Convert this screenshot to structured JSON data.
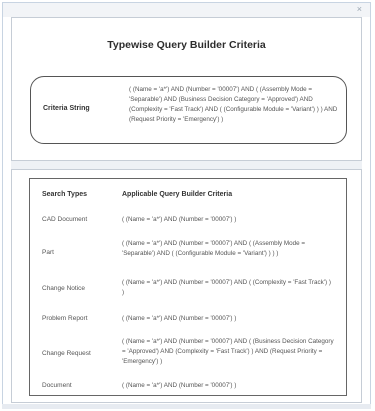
{
  "dialog": {
    "close_label": "×",
    "title": "Typewise Query Builder Criteria"
  },
  "criteria_string": {
    "label": "Criteria String",
    "value": "( (Name = 'a*') AND (Number = '00007') AND ( (Assembly Mode = 'Separable') AND (Business Decision Category = 'Approved') AND (Complexity = 'Fast Track') AND ( (Configurable Module = 'Variant') ) ) AND (Request Priority = 'Emergency') )"
  },
  "table": {
    "headers": {
      "types": "Search Types",
      "criteria": "Applicable Query Builder Criteria"
    },
    "rows": [
      {
        "type": "CAD Document",
        "criteria": "( (Name = 'a*') AND (Number = '00007') )"
      },
      {
        "type": "Part",
        "criteria": "( (Name = 'a*') AND (Number = '00007') AND ( (Assembly Mode = 'Separable') AND ( (Configurable Module = 'Variant') ) ) )"
      },
      {
        "type": "Change Notice",
        "criteria": "( (Name = 'a*') AND (Number = '00007') AND ( (Complexity = 'Fast Track') ) )"
      },
      {
        "type": "Problem Report",
        "criteria": "( (Name = 'a*') AND (Number = '00007') )"
      },
      {
        "type": "Change Request",
        "criteria": "( (Name = 'a*') AND (Number = '00007') AND ( (Business Decision Category = 'Approved') AND (Complexity = 'Fast Track') ) AND (Request Priority = 'Emergency') )"
      },
      {
        "type": "Document",
        "criteria": "( (Name = 'a*') AND (Number = '00007') )"
      }
    ]
  }
}
